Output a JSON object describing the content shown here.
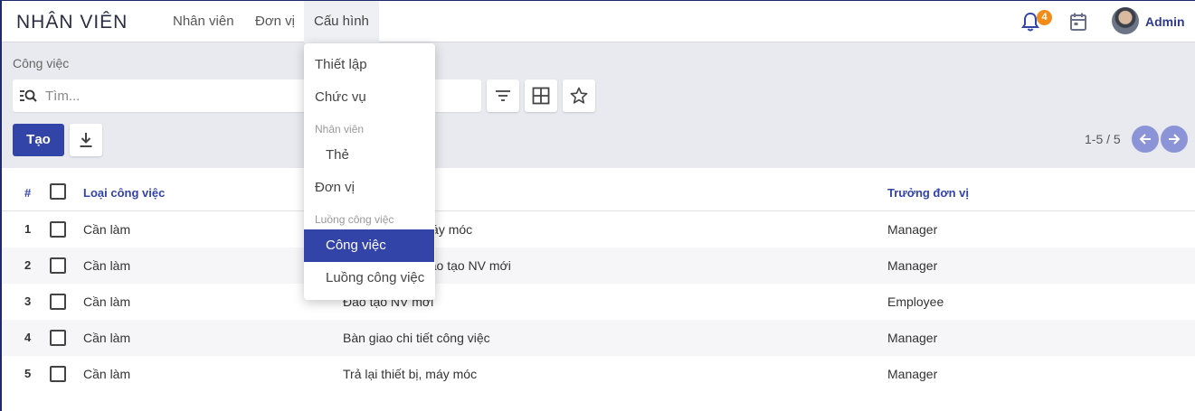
{
  "app": {
    "title": "NHÂN VIÊN"
  },
  "nav": {
    "items": [
      {
        "label": "Nhân viên"
      },
      {
        "label": "Đơn vị"
      },
      {
        "label": "Cấu hình"
      }
    ]
  },
  "topbar": {
    "notification_count": "4",
    "user_name": "Admin",
    "accent": "#3344a8",
    "badge_color": "#f28c18"
  },
  "breadcrumb": "Công việc",
  "search": {
    "placeholder": "Tìm..."
  },
  "toolbar": {
    "create_label": "Tạo",
    "filter_icon": "filter-icon",
    "grid_icon": "grid-view-icon",
    "favorite_icon": "star-icon",
    "download_icon": "download-icon"
  },
  "pager": {
    "value": "1-5 / 5"
  },
  "table": {
    "headers": {
      "num": "#",
      "type": "Loại công việc",
      "name": "",
      "manager": "Trưởng đơn vị"
    },
    "rows": [
      {
        "num": "1",
        "type": "Cần làm",
        "name": "Nhận thiết bị, máy móc",
        "manager": "Manager"
      },
      {
        "num": "2",
        "type": "Cần làm",
        "name": "Lên kế hoạch đào tạo NV mới",
        "manager": "Manager"
      },
      {
        "num": "3",
        "type": "Cần làm",
        "name": "Đào tạo NV mới",
        "manager": "Employee"
      },
      {
        "num": "4",
        "type": "Cần làm",
        "name": "Bàn giao chi tiết công việc",
        "manager": "Manager"
      },
      {
        "num": "5",
        "type": "Cần làm",
        "name": "Trả lại thiết bị, máy móc",
        "manager": "Manager"
      }
    ]
  },
  "dropdown": {
    "item_setup": "Thiết lập",
    "item_position": "Chức vụ",
    "header_employee": "Nhân viên",
    "item_tag": "Thẻ",
    "item_unit": "Đơn vị",
    "header_workflow": "Luồng công việc",
    "item_task": "Công việc",
    "item_workflow": "Luồng công việc"
  }
}
